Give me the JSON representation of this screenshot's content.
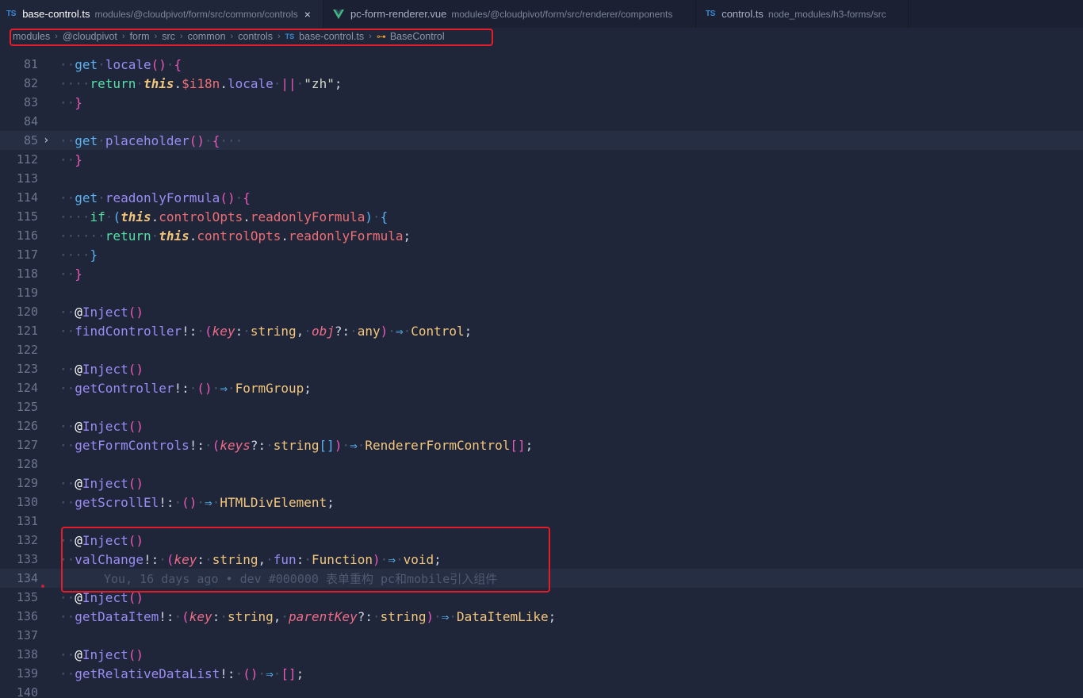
{
  "tabs": [
    {
      "lang": "TS",
      "name": "base-control.ts",
      "path": "modules/@cloudpivot/form/src/common/controls",
      "active": true,
      "close": "×"
    },
    {
      "lang": "vue",
      "name": "pc-form-renderer.vue",
      "path": "modules/@cloudpivot/form/src/renderer/components",
      "active": false
    },
    {
      "lang": "TS",
      "name": "control.ts",
      "path": "node_modules/h3-forms/src",
      "active": false
    }
  ],
  "breadcrumb": {
    "items": [
      "modules",
      "@cloudpivot",
      "form",
      "src",
      "common",
      "controls"
    ],
    "file_lang": "TS",
    "file": "base-control.ts",
    "symbol": "BaseControl"
  },
  "lines": {
    "l81": "81",
    "l82": "82",
    "l83": "83",
    "l84": "84",
    "l85": "85",
    "l112": "112",
    "l113": "113",
    "l114": "114",
    "l115": "115",
    "l116": "116",
    "l117": "117",
    "l118": "118",
    "l119": "119",
    "l120": "120",
    "l121": "121",
    "l122": "122",
    "l123": "123",
    "l124": "124",
    "l125": "125",
    "l126": "126",
    "l127": "127",
    "l128": "128",
    "l129": "129",
    "l130": "130",
    "l131": "131",
    "l132": "132",
    "l133": "133",
    "l134": "134",
    "l135": "135",
    "l136": "136",
    "l137": "137",
    "l138": "138",
    "l139": "139",
    "l140": "140"
  },
  "blame": "You, 16 days ago • dev #000000 表单重构 pc和mobile引入组件",
  "colors": {
    "background": "#1f2639",
    "highlight_box": "#e31c2a",
    "keyword": "#5ab3f2",
    "type": "#f2c57a",
    "function": "#9a8cf5"
  }
}
